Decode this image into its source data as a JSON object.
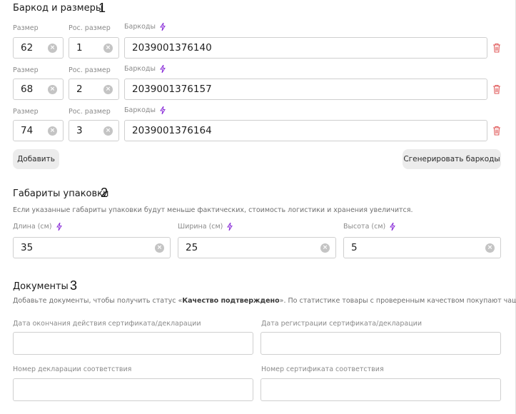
{
  "barcodes": {
    "title": "Баркод и размеры",
    "marker": "1",
    "size_label": "Размер",
    "ru_size_label": "Рос. размер",
    "barcodes_label": "Баркоды",
    "rows": [
      {
        "size": "62",
        "ru_size": "1",
        "barcode": "2039001376140"
      },
      {
        "size": "68",
        "ru_size": "2",
        "barcode": "2039001376157"
      },
      {
        "size": "74",
        "ru_size": "3",
        "barcode": "2039001376164"
      }
    ],
    "add_button": "Добавить",
    "generate_button": "Сгенерировать баркоды"
  },
  "packaging": {
    "title": "Габариты упаковки",
    "marker": "2",
    "description": "Если указанные габариты упаковки будут меньше фактических, стоимость логистики и хранения увеличится.",
    "length_label": "Длина (см)",
    "length_value": "35",
    "width_label": "Ширина (см)",
    "width_value": "25",
    "height_label": "Высота (см)",
    "height_value": "5"
  },
  "documents": {
    "title": "Документы",
    "marker": "3",
    "description_prefix": "Добавьте документы, чтобы получить статус «",
    "description_bold": "Качество подтверждено",
    "description_suffix": "». По статистике товары с проверенным качеством покупают чаще.",
    "cert_end_label": "Дата окончания действия сертификата/декларации",
    "cert_end_value": "",
    "cert_reg_label": "Дата регистрации сертификата/декларации",
    "cert_reg_value": "",
    "decl_number_label": "Номер декларации соответствия",
    "decl_number_value": "",
    "cert_number_label": "Номер сертификата соответствия",
    "cert_number_value": ""
  },
  "colors": {
    "accent_bolt": "#8b2fd9",
    "trash": "#e05a5a",
    "border": "#cfcfcf"
  },
  "icons": {
    "clear": "clear-icon",
    "bolt": "lightning-icon",
    "trash": "trash-icon"
  }
}
